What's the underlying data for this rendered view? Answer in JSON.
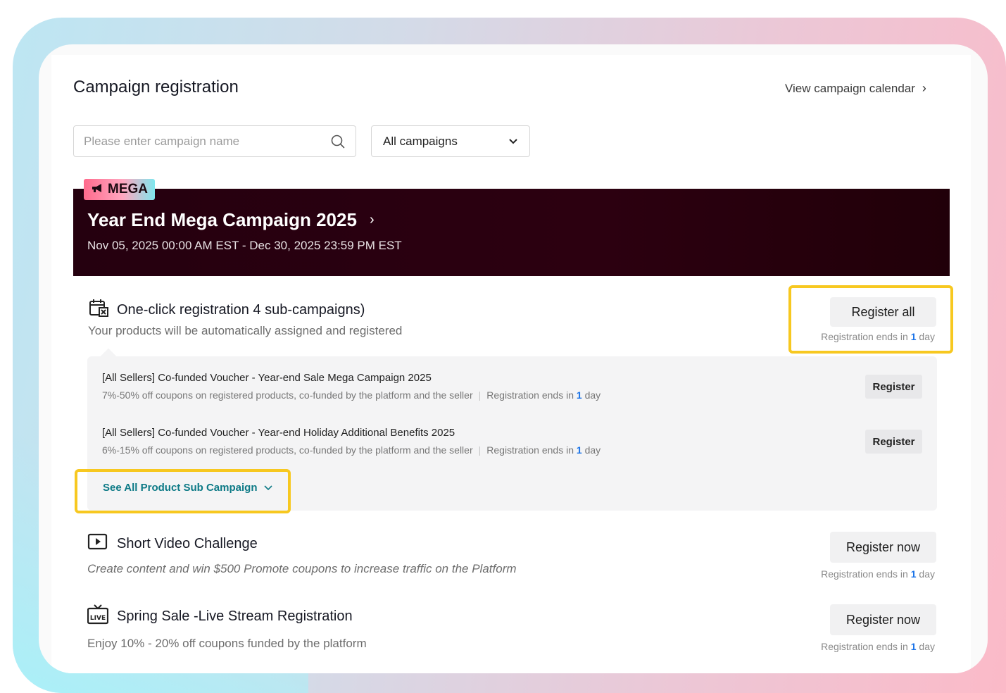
{
  "header": {
    "title": "Campaign registration",
    "calendar_link": "View campaign calendar"
  },
  "filters": {
    "search_placeholder": "Please enter campaign name",
    "campaign_select": "All campaigns"
  },
  "banner": {
    "badge": "MEGA",
    "title": "Year End Mega Campaign 2025",
    "dates": "Nov 05, 2025 00:00 AM EST - Dec 30, 2025 23:59 PM EST"
  },
  "one_click": {
    "title": "One-click registration 4 sub-campaigns)",
    "description": "Your products will be automatically assigned and registered",
    "button": "Register all",
    "ends_prefix": "Registration ends in",
    "ends_num": "1",
    "ends_unit": "day"
  },
  "sub_campaigns": [
    {
      "title": "[All Sellers] Co-funded Voucher - Year-end Sale Mega Campaign 2025",
      "description": "7%-50% off coupons on registered products, co-funded by the platform and the seller",
      "ends_prefix": "Registration ends in",
      "ends_num": "1",
      "ends_unit": "day",
      "button": "Register"
    },
    {
      "title": "[All Sellers] Co-funded Voucher - Year-end Holiday Additional Benefits 2025",
      "description": "6%-15% off coupons on registered products, co-funded by the platform and the seller",
      "ends_prefix": "Registration ends in",
      "ends_num": "1",
      "ends_unit": "day",
      "button": "Register"
    }
  ],
  "see_all": "See All Product Sub Campaign",
  "campaigns": [
    {
      "title": "Short Video Challenge",
      "description": "Create content and win $500 Promote coupons to increase traffic on the Platform",
      "button": "Register now",
      "ends_prefix": "Registration ends in",
      "ends_num": "1",
      "ends_unit": "day"
    },
    {
      "title": "Spring Sale -Live Stream Registration",
      "description": "Enjoy 10% - 20% off coupons funded by the platform",
      "button": "Register now",
      "ends_prefix": "Registration ends in",
      "ends_num": "1",
      "ends_unit": "day"
    }
  ],
  "colors": {
    "highlight": "#f7c820",
    "banner_bg": "#2c0010",
    "link_teal": "#0d7a86",
    "accent_blue": "#1a73e8"
  }
}
